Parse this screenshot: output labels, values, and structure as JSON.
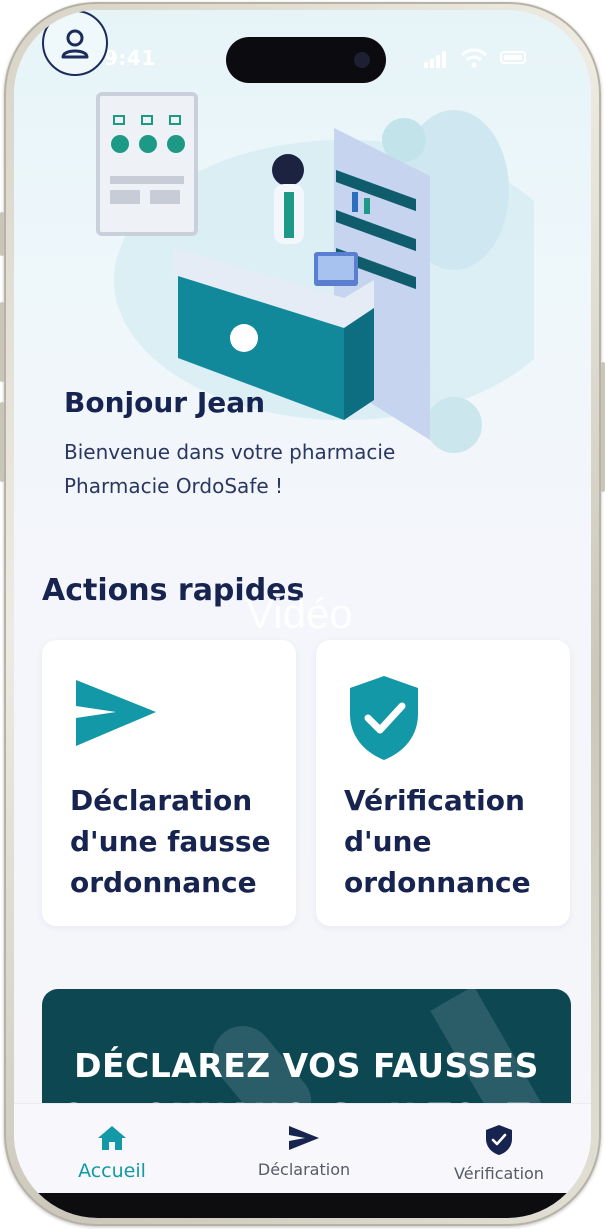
{
  "status": {
    "time": "9:41"
  },
  "greeting": {
    "title": "Bonjour Jean",
    "line1": "Bienvenue dans votre pharmacie",
    "line2": "Pharmacie OrdoSafe !"
  },
  "quick_actions": {
    "title": "Actions rapides",
    "watermark": "Vidéo",
    "cards": [
      {
        "label": "Déclaration d'une fausse ordonnance",
        "icon": "send-icon"
      },
      {
        "label": "Vérification d'une ordonnance",
        "icon": "shield-check-icon"
      }
    ]
  },
  "banner": {
    "text": "DÉCLAREZ VOS FAUSSES ORDONNANCES EN TOUTE"
  },
  "tabs": [
    {
      "label": "Accueil",
      "icon": "home-icon",
      "active": true
    },
    {
      "label": "Déclaration",
      "icon": "send-icon",
      "active": false
    },
    {
      "label": "Vérification",
      "icon": "shield-check-icon",
      "active": false
    }
  ],
  "colors": {
    "accent": "#1298a6",
    "navy": "#16244f",
    "banner": "#0d4752"
  }
}
